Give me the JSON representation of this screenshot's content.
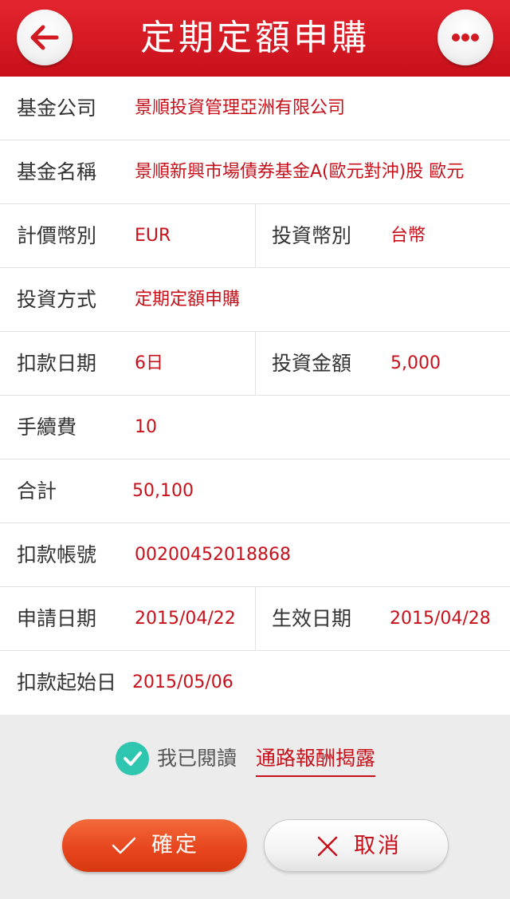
{
  "header": {
    "title": "定期定額申購"
  },
  "rows": {
    "company": {
      "label": "基金公司",
      "value": "景順投資管理亞洲有限公司"
    },
    "fund_name": {
      "label": "基金名稱",
      "value": "景順新興市場債券基金A(歐元對沖)股 歐元"
    },
    "pricing_currency": {
      "label": "計價幣別",
      "value": "EUR"
    },
    "invest_currency": {
      "label": "投資幣別",
      "value": "台幣"
    },
    "method": {
      "label": "投資方式",
      "value": "定期定額申購"
    },
    "debit_date": {
      "label": "扣款日期",
      "value": "6日"
    },
    "amount": {
      "label": "投資金額",
      "value": "5,000"
    },
    "fee": {
      "label": "手續費",
      "value": "10"
    },
    "total": {
      "label": "合計",
      "value": "50,100"
    },
    "account": {
      "label": "扣款帳號",
      "value": "00200452018868"
    },
    "apply_date": {
      "label": "申請日期",
      "value": "2015/04/22"
    },
    "effective_date": {
      "label": "生效日期",
      "value": "2015/04/28"
    },
    "start_date": {
      "label": "扣款起始日",
      "value": "2015/05/06"
    }
  },
  "agreement": {
    "prefix": "我已閱讀",
    "link": "通路報酬揭露",
    "checked": true
  },
  "buttons": {
    "confirm": "確定",
    "cancel": "取消"
  },
  "colors": {
    "brand_red": "#c8101a",
    "confirm_orange": "#e8461e",
    "check_teal": "#2fc6b0"
  },
  "icons": {
    "back": "back-arrow-icon",
    "more": "more-dots-icon",
    "check": "check-circle-icon"
  }
}
